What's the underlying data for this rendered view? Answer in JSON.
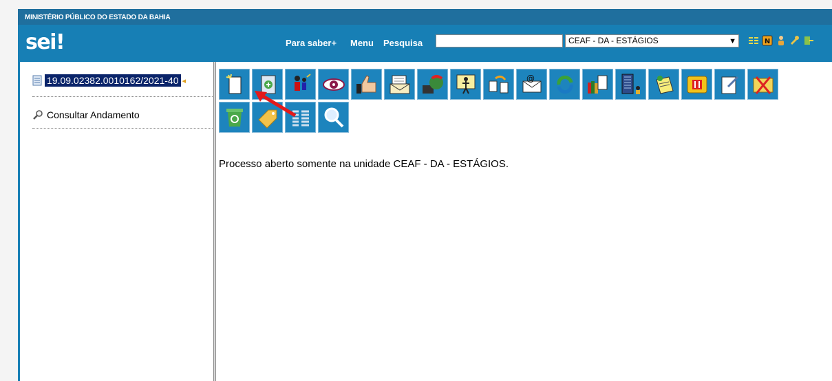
{
  "header": {
    "org_name": "MINISTÉRIO PÚBLICO DO ESTADO DA BAHIA",
    "logo_text": "sei",
    "logo_mark": "!",
    "links": [
      "Para saber+",
      "Menu",
      "Pesquisa"
    ],
    "search_value": "",
    "unit_selected": "CEAF - DA - ESTÁGIOS",
    "icons": [
      "list-icon",
      "notifications-icon",
      "user-icon",
      "settings-wrench-icon",
      "exit-icon"
    ]
  },
  "tree": {
    "process_number": "19.09.02382.0010162/2021-40",
    "consult_label": "Consultar Andamento"
  },
  "toolbar": {
    "row1": [
      "new-document-icon",
      "start-related-process-icon",
      "assign-process-icon",
      "follow-process-icon",
      "approve-icon",
      "send-process-icon",
      "update-icon",
      "assign-person-icon",
      "move-documents-icon",
      "send-email-icon",
      "relate-icon",
      "include-in-block-icon",
      "unit-icon",
      "annotation-icon",
      "suspend-icon",
      "edit-process-icon",
      "cancel-icon"
    ],
    "row2": [
      "recycle-icon",
      "tag-icon",
      "list-view-icon",
      "search-icon"
    ]
  },
  "main": {
    "status_message": "Processo aberto somente na unidade CEAF - DA - ESTÁGIOS."
  },
  "colors": {
    "topbar": "#1f6f9e",
    "header": "#177fb5",
    "toolbar_button": "#1d84bd",
    "selection": "#0a246a",
    "annotation_arrow": "#e41a1a"
  }
}
